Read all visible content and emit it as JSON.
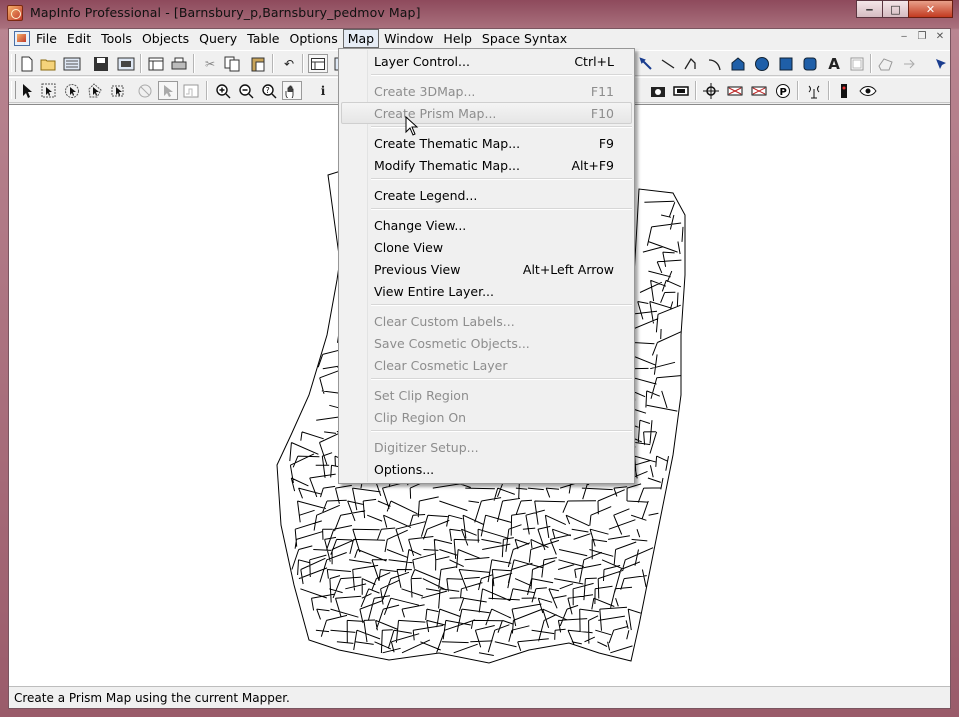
{
  "window": {
    "title": "MapInfo Professional - [Barnsbury_p,Barnsbury_pedmov Map]",
    "buttons": {
      "minimize": "‒",
      "maximize": "□",
      "close": "✕"
    }
  },
  "menubar": {
    "items": [
      "File",
      "Edit",
      "Tools",
      "Objects",
      "Query",
      "Table",
      "Options",
      "Map",
      "Window",
      "Help",
      "Space Syntax"
    ],
    "active": "Map",
    "mdi": {
      "minimize": "‒",
      "restore": "❐",
      "close": "✕"
    }
  },
  "map_menu": {
    "items": [
      {
        "label": "Layer Control...",
        "shortcut": "Ctrl+L",
        "enabled": true
      },
      {
        "label": "Create 3DMap...",
        "shortcut": "F11",
        "enabled": false
      },
      {
        "label": "Create Prism Map...",
        "shortcut": "F10",
        "enabled": false,
        "hover": true
      },
      {
        "label": "Create Thematic Map...",
        "shortcut": "F9",
        "enabled": true
      },
      {
        "label": "Modify Thematic Map...",
        "shortcut": "Alt+F9",
        "enabled": true
      },
      {
        "label": "Create Legend...",
        "shortcut": "",
        "enabled": true
      },
      {
        "label": "Change View...",
        "shortcut": "",
        "enabled": true
      },
      {
        "label": "Clone View",
        "shortcut": "",
        "enabled": true
      },
      {
        "label": "Previous View",
        "shortcut": "Alt+Left Arrow",
        "enabled": true
      },
      {
        "label": "View Entire Layer...",
        "shortcut": "",
        "enabled": true
      },
      {
        "label": "Clear Custom Labels...",
        "shortcut": "",
        "enabled": false
      },
      {
        "label": "Save Cosmetic Objects...",
        "shortcut": "",
        "enabled": false
      },
      {
        "label": "Clear Cosmetic Layer",
        "shortcut": "",
        "enabled": false
      },
      {
        "label": "Set Clip Region",
        "shortcut": "",
        "enabled": false
      },
      {
        "label": "Clip Region On",
        "shortcut": "",
        "enabled": false
      },
      {
        "label": "Digitizer Setup...",
        "shortcut": "",
        "enabled": false
      },
      {
        "label": "Options...",
        "shortcut": "",
        "enabled": true
      }
    ]
  },
  "statusbar": {
    "message": "Create a Prism Map using the current Mapper."
  },
  "colors": {
    "frame": "#9a5b6a",
    "menu_bg": "#f0f0f0",
    "disabled_text": "#8d8d8d",
    "map_bg": "#ffffff",
    "street_lines": "#000000"
  },
  "toolbar_icons": {
    "main": [
      "new-icon",
      "open-icon",
      "open-workspace-icon",
      "save-icon",
      "save-workspace-icon",
      "new-browser-icon",
      "print-icon",
      "cut-icon",
      "copy-icon",
      "paste-icon",
      "undo-icon",
      "new-browser-window-icon",
      "new-mapper-icon"
    ],
    "drawing": [
      "symbol-style-icon",
      "line-icon",
      "polyline-icon",
      "arc-icon",
      "polygon-icon",
      "ellipse-icon",
      "rectangle-icon",
      "rounded-rectangle-icon",
      "text-icon",
      "frame-icon",
      "reshape-icon",
      "add-node-icon",
      "select-node-icon"
    ],
    "tools": [
      "select-icon",
      "marquee-select-icon",
      "radius-select-icon",
      "polygon-select-icon",
      "boundary-select-icon",
      "unselect-icon",
      "invert-select-icon",
      "graph-select-icon",
      "zoom-in-icon",
      "zoom-out-icon",
      "change-view-icon",
      "grabber-icon",
      "info-icon"
    ],
    "tools_right": [
      "camera-icon",
      "ruler-icon",
      "crosshair-icon",
      "drag-map-icon",
      "hotlink-icon",
      "parking-icon",
      "antenna-icon",
      "traffic-light-icon",
      "eye-icon"
    ]
  }
}
